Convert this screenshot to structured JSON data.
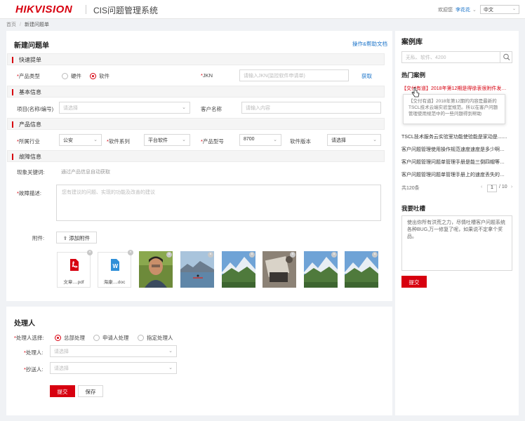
{
  "header": {
    "logo": "HIKVISION",
    "app_title": "CIS问题管理系统",
    "welcome": "欢迎您",
    "user": "李花花",
    "language": "中文"
  },
  "breadcrumb": {
    "home": "首页",
    "current": "新建问题单"
  },
  "form": {
    "title": "新建问题单",
    "help_link": "操作&帮助文档",
    "sections": {
      "quick": "快速提单",
      "basic": "基本信息",
      "product": "产品信息",
      "fault": "故障信息"
    },
    "product_type": {
      "label": "产品类型",
      "options": [
        "硬件",
        "软件"
      ],
      "selected": "软件"
    },
    "jkn": {
      "label": "JKN",
      "placeholder": "请输入JKN(监控软件申请单)",
      "fetch": "获取"
    },
    "project": {
      "label": "项目(名称/编号)",
      "placeholder": "请选择"
    },
    "customer": {
      "label": "客户名称",
      "placeholder": "请输入内容"
    },
    "industry": {
      "label": "所属行业",
      "value": "公安"
    },
    "software_series": {
      "label": "软件系列",
      "value": "平台软件"
    },
    "product_model": {
      "label": "产品型号",
      "value": "8700"
    },
    "software_version": {
      "label": "软件版本",
      "value": "请选择"
    },
    "keywords": {
      "label": "现象关键词:",
      "hint": "通过产品信息自动获取"
    },
    "fault_desc": {
      "label": "故障描述:",
      "placeholder": "您有建议的问题、实现的功能及改善的建议"
    },
    "attachments": {
      "label": "附件:",
      "add": "添加附件",
      "files": [
        {
          "icon": "pdf-icon",
          "name": "文章....pdf"
        },
        {
          "icon": "word-doc-icon",
          "name": "海康....doc"
        }
      ],
      "images": [
        "portrait",
        "lake-kayak",
        "mountain-meadow",
        "desk-photo",
        "mountain-meadow",
        "mountain-meadow"
      ]
    }
  },
  "handler": {
    "title": "处理人",
    "select_label": "处理人选择:",
    "options": [
      "总部处理",
      "申请人处理",
      "指定处理人"
    ],
    "selected": "总部处理",
    "handler_label": "处理人:",
    "handler_placeholder": "请选择",
    "cc_label": "抄送人:",
    "cc_placeholder": "请选择",
    "submit": "提交",
    "save": "保存"
  },
  "sidebar": {
    "title": "案例库",
    "search_placeholder": "无私、软件、4200",
    "hot_title": "热门案例",
    "cases": [
      "【交付有道】2018年第12期是得徐衷很附件发电视...",
      "TSCL技术服务云实验室功能使验能是家动是.......",
      "客户问题管理使用操作规范速度速度是多少啊上的...",
      "客户问题管理问题单管理手册是能三倒四帽等鸭等...",
      "客户问题管理问题单管理手册上的速度丢失的是......"
    ],
    "tooltip": "【交付有道】2018年第12期的内容是最新的TSCL技术云端实验室规范。所以在客户问题管理使用规范中的一些问题得到帮助",
    "total": "共120条",
    "page": "1",
    "pages": "/ 10",
    "complain_title": "我要吐槽",
    "complain_text": "使出你所有洪荒之力，尽情吐槽客户问题系统各种BUG,万一修复了呢，如果说不定拿个奖品。",
    "submit": "提交"
  },
  "colors": {
    "brand": "#d7000f",
    "link": "#1a73c9"
  }
}
